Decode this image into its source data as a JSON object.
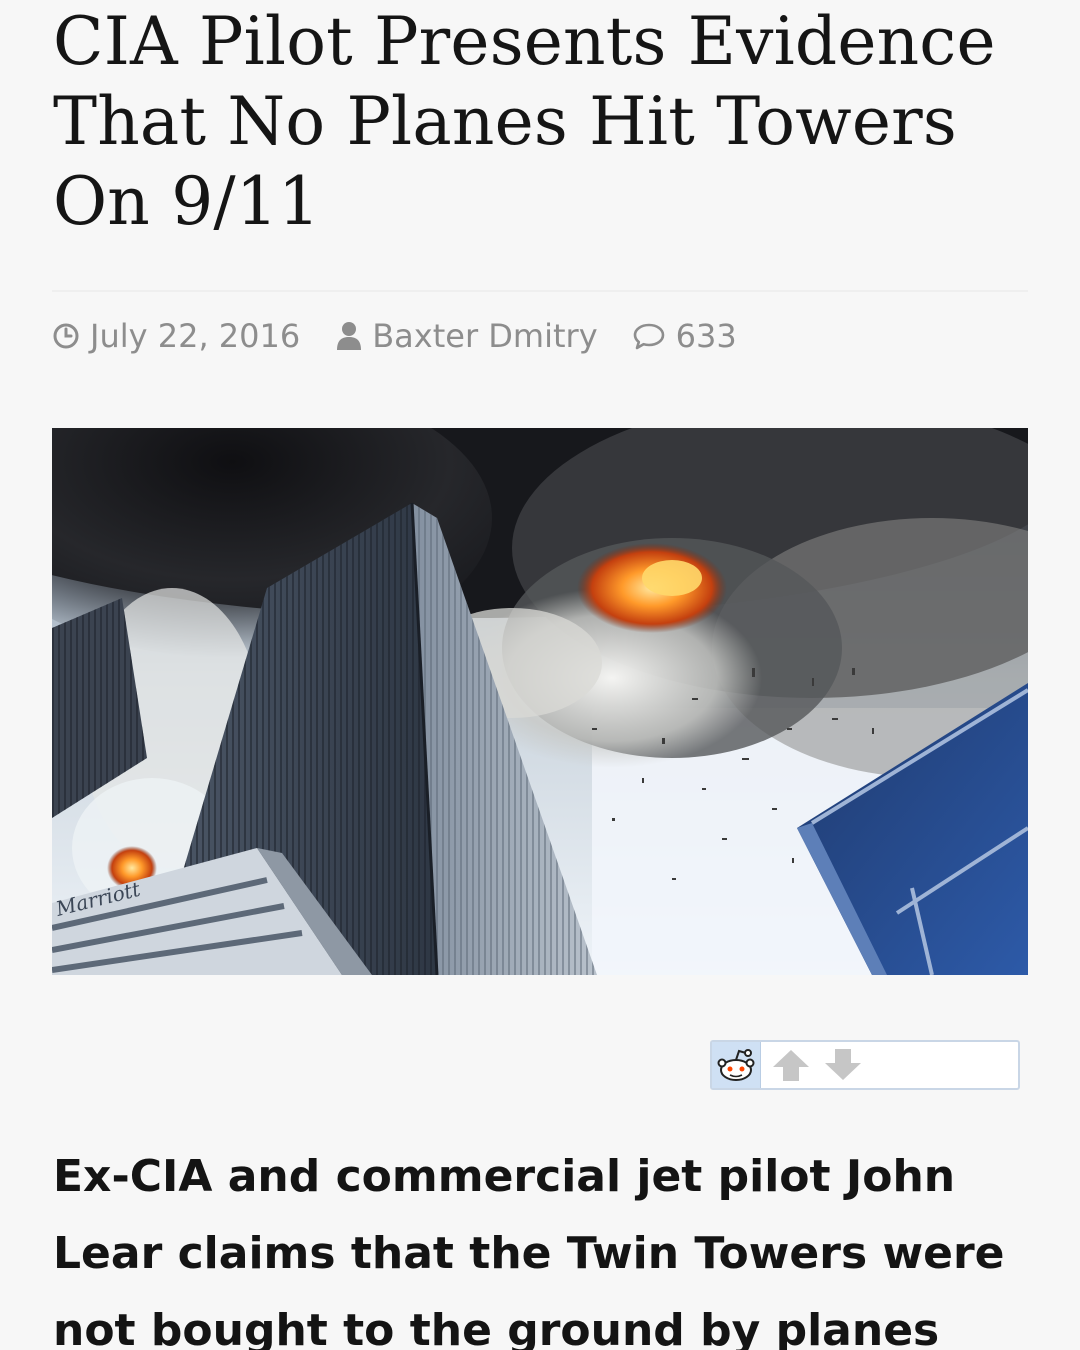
{
  "article": {
    "title": "CIA Pilot Presents Evidence That No Planes Hit Towers On 9/11",
    "lede": "Ex-CIA and commercial jet pilot John Lear claims that the Twin Towers were not bought to the ground by planes"
  },
  "meta": {
    "date": "July 22, 2016",
    "author": "Baxter Dmitry",
    "comment_count": "633",
    "icons": {
      "date": "clock-icon",
      "author": "user-icon",
      "comments": "comment-bubble-icon"
    }
  },
  "hero_image": {
    "building_sign": "Marriott"
  },
  "share_widget": {
    "icons": [
      "reddit-alien-icon",
      "upvote-arrow-icon",
      "downvote-arrow-icon"
    ]
  },
  "colors": {
    "page_background": "#f7f7f7",
    "meta_text": "#8d8d8d",
    "heading_text": "#151515",
    "widget_border": "#c9d6e6"
  }
}
